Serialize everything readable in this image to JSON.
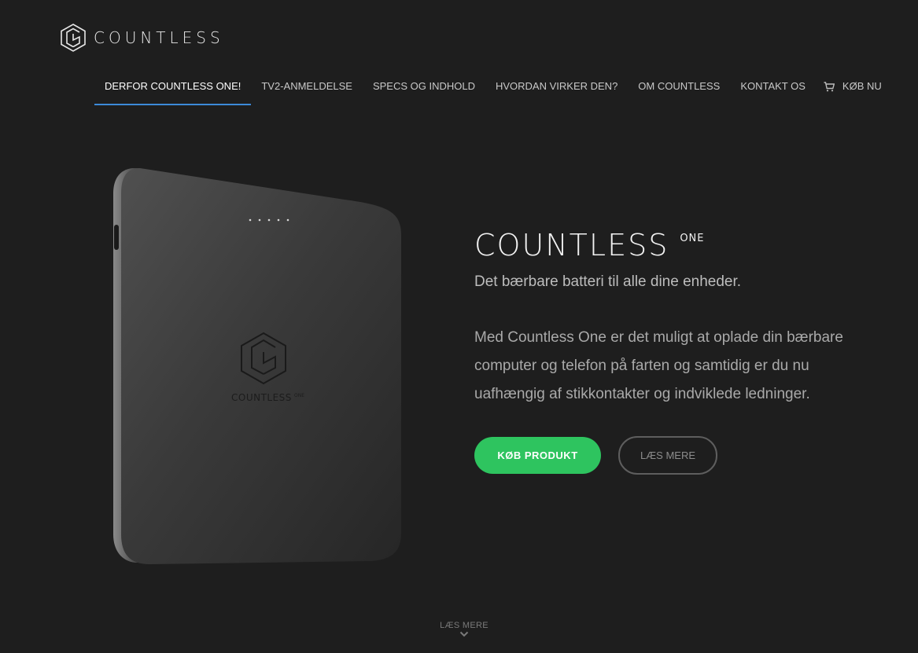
{
  "brand": {
    "name": "COUNTLESS",
    "logo_icon": "countless-hexagon-logo"
  },
  "nav": {
    "items": [
      {
        "label": "DERFOR COUNTLESS ONE!",
        "active": true
      },
      {
        "label": "TV2-ANMELDELSE",
        "active": false
      },
      {
        "label": "SPECS OG INDHOLD",
        "active": false
      },
      {
        "label": "HVORDAN VIRKER DEN?",
        "active": false
      },
      {
        "label": "OM COUNTLESS",
        "active": false
      },
      {
        "label": "KONTAKT OS",
        "active": false
      }
    ],
    "buy": {
      "label": "KØB NU",
      "icon": "cart-icon"
    },
    "active_color": "#3c8ad8"
  },
  "product": {
    "device_brand": "COUNTLESS",
    "device_sup": "ONE",
    "indicator_leds": 5
  },
  "hero": {
    "title": "COUNTLESS",
    "title_sup": "ONE",
    "subtitle": "Det bærbare batteri til alle dine enheder.",
    "body": "Med Countless One er det muligt at oplade din bærbare computer og telefon på farten og samtidig er du nu uafhængig af stikkontakter og indviklede ledninger.",
    "buy_button": "KØB PRODUKT",
    "more_button": "LÆS MERE",
    "buy_color": "#2ec45f"
  },
  "scroll": {
    "label": "LÆS MERE",
    "icon": "chevron-down-icon"
  }
}
